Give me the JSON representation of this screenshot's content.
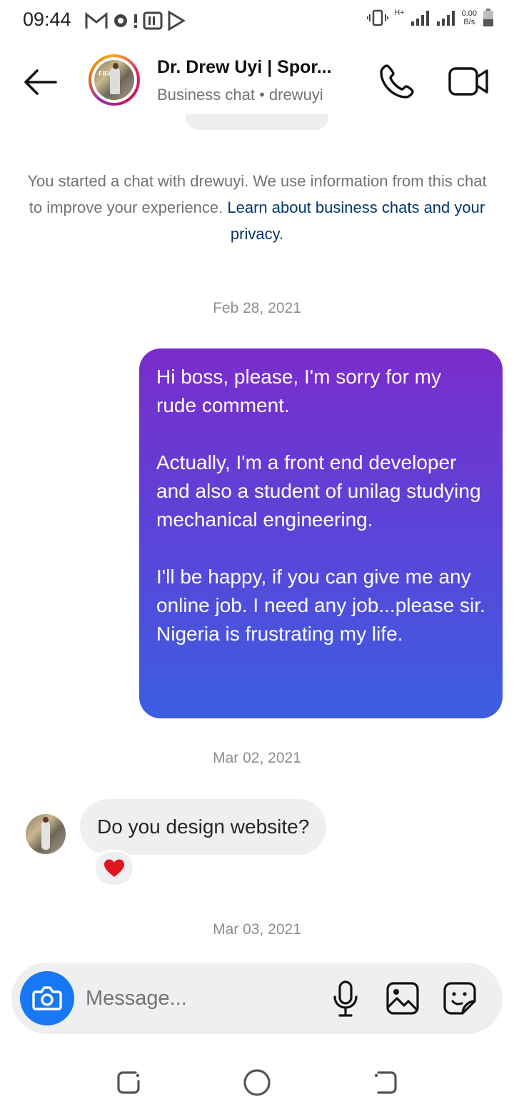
{
  "status_bar": {
    "time": "09:44",
    "net_speed_value": "0.00",
    "net_speed_unit": "B/s",
    "network_type": "H+"
  },
  "header": {
    "title": "Dr. Drew Uyi | Spor...",
    "subtitle": "Business chat • drewuyi",
    "avatar_logo_text": "FIFA"
  },
  "chat": {
    "info_text": "You started a chat with drewuyi. We use information from this chat to improve your experience.",
    "info_link": "Learn about business chats and your privacy.",
    "date_1": "Feb 28, 2021",
    "outgoing_message": {
      "paragraph_1": "Hi boss, please, I'm sorry for my rude comment.",
      "paragraph_2": "Actually, I'm a front end developer and also a student of unilag studying mechanical engineering.",
      "paragraph_3": "I'll be happy, if you can give me any online job. I need any job...please sir. Nigeria is frustrating my life."
    },
    "date_2": "Mar 02, 2021",
    "incoming_message": "Do you design website?",
    "reaction": "❤️",
    "date_3": "Mar 03, 2021"
  },
  "composer": {
    "placeholder": "Message..."
  },
  "colors": {
    "bubble_gradient_top": "#7b2ccb",
    "bubble_gradient_bottom": "#3b5fe0",
    "camera_button": "#1877f2",
    "link": "#00376b"
  },
  "icons": {
    "back": "arrow-left-icon",
    "call": "phone-icon",
    "video": "video-camera-icon",
    "camera": "camera-icon",
    "mic": "microphone-icon",
    "gallery": "image-icon",
    "sticker": "sticker-icon"
  }
}
